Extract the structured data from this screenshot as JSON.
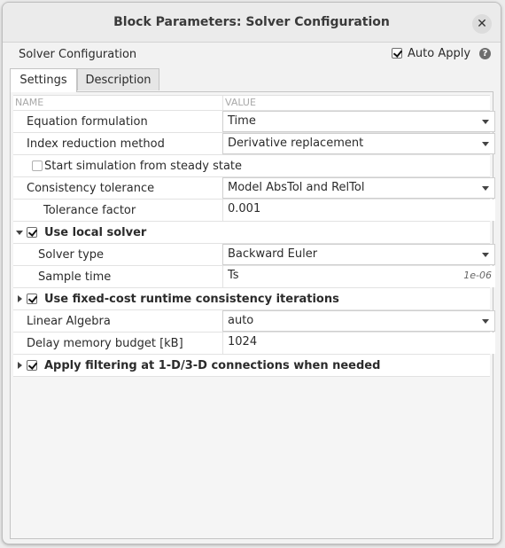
{
  "window": {
    "title": "Block Parameters: Solver Configuration",
    "close_glyph": "✕"
  },
  "header": {
    "block_name": "Solver Configuration",
    "auto_apply_label": "Auto Apply",
    "auto_apply_checked": true,
    "help_glyph": "?"
  },
  "tabs": [
    {
      "label": "Settings",
      "active": true
    },
    {
      "label": "Description",
      "active": false
    }
  ],
  "table": {
    "columns": {
      "name": "NAME",
      "value": "VALUE"
    },
    "rows": {
      "equation_formulation": {
        "label": "Equation formulation",
        "value": "Time"
      },
      "index_reduction": {
        "label": "Index reduction method",
        "value": "Derivative replacement"
      },
      "steady_state": {
        "label": "Start simulation from steady state",
        "checked": false
      },
      "consistency_tolerance": {
        "label": "Consistency tolerance",
        "value": "Model AbsTol and RelTol"
      },
      "tolerance_factor": {
        "label": "Tolerance factor",
        "value": "0.001"
      },
      "use_local_solver": {
        "label": "Use local solver",
        "checked": true,
        "expanded": true
      },
      "solver_type": {
        "label": "Solver type",
        "value": "Backward Euler"
      },
      "sample_time": {
        "label": "Sample time",
        "value": "Ts",
        "units": "1e-06"
      },
      "fixed_cost": {
        "label": "Use fixed-cost runtime consistency iterations",
        "checked": true,
        "expanded": false
      },
      "linear_algebra": {
        "label": "Linear Algebra",
        "value": "auto"
      },
      "delay_memory": {
        "label": "Delay memory budget [kB]",
        "value": "1024"
      },
      "filtering": {
        "label": "Apply filtering at 1-D/3-D connections when needed",
        "checked": true,
        "expanded": false
      }
    }
  }
}
